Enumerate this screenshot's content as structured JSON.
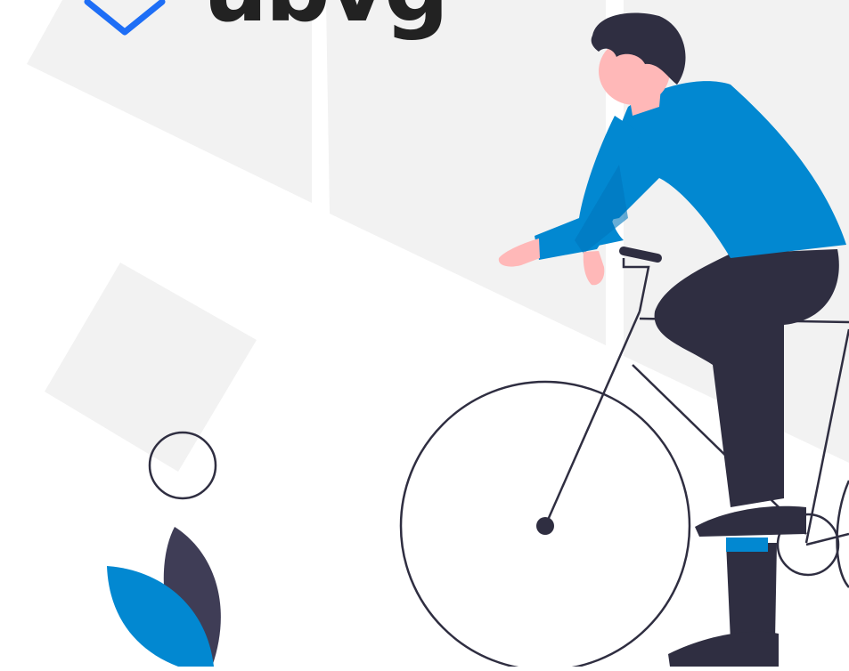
{
  "logo": {
    "wordmark": "ubvg",
    "icon": "chevron-down-icon"
  },
  "colors": {
    "background": "#ffffff",
    "panel": "#f2f2f2",
    "accent_blue": "#0288d1",
    "logo_blue": "#1e6ef6",
    "dark": "#2f2e41",
    "skin": "#ffb8b8",
    "shoe_accent": "#0288d1",
    "text_dark": "#222222"
  }
}
